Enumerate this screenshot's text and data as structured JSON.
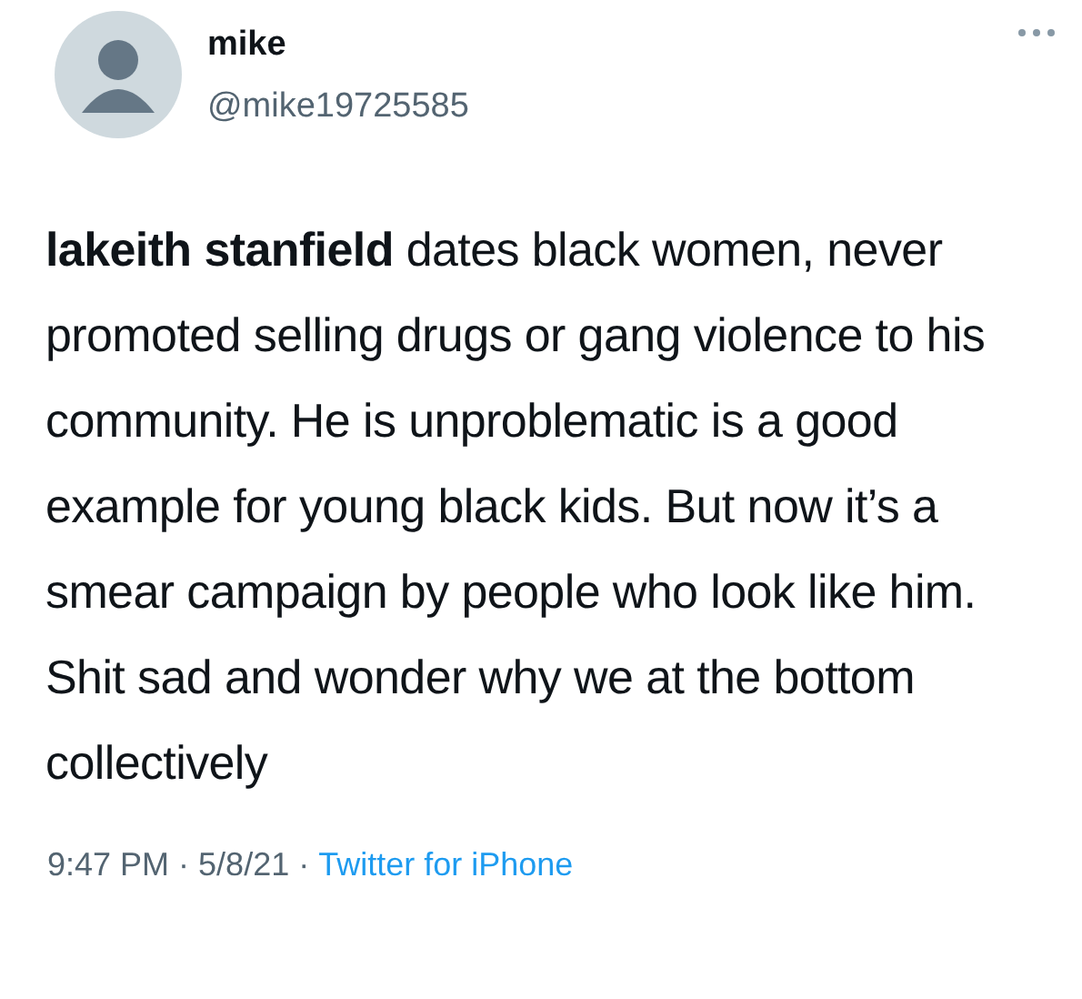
{
  "author": {
    "name": "mike",
    "handle": "@mike19725585"
  },
  "tweet": {
    "text": "**lakeith stanfield** dates black women, never promoted selling drugs or gang violence to his community. He is unproblematic is a good example for young black kids. But now it’s a smear campaign by people who look like him. Shit sad and wonder why we at the bottom collectively"
  },
  "footer": [
    {
      "kind": "time",
      "text": "9:47 PM"
    },
    {
      "kind": "separator",
      "text": "·"
    },
    {
      "kind": "date",
      "text": "5/8/21"
    },
    {
      "kind": "separator",
      "text": "·"
    },
    {
      "kind": "link",
      "text": "Twitter for iPhone"
    }
  ]
}
